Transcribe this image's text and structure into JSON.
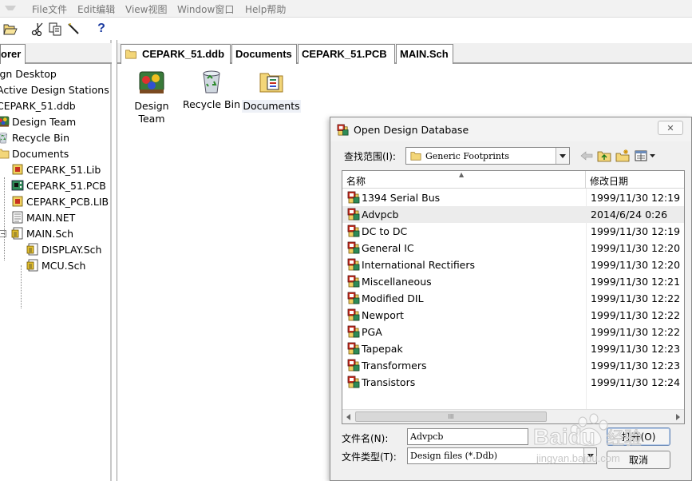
{
  "menubar": {
    "items": [
      "File文件",
      "Edit编辑",
      "View视图",
      "Window窗口",
      "Help帮助"
    ]
  },
  "toolbar": {
    "buttons": [
      "open-folder-icon",
      "cut-icon",
      "copy-icon",
      "paste-icon",
      "help-icon"
    ],
    "help_label": "?"
  },
  "explorer": {
    "tab_label": "orer",
    "tree": [
      {
        "label": "ign Desktop",
        "icon": "desktop-icon"
      },
      {
        "label": "Active Design Stations",
        "icon": "stations-icon"
      },
      {
        "label": "CEPARK_51.ddb",
        "icon": "database-icon"
      },
      {
        "label": "Design Team",
        "icon": "design-team-icon"
      },
      {
        "label": "Recycle Bin",
        "icon": "recycle-bin-icon"
      },
      {
        "label": "Documents",
        "icon": "folder-icon"
      },
      {
        "label": "CEPARK_51.Lib",
        "icon": "schematic-lib-icon"
      },
      {
        "label": "CEPARK_51.PCB",
        "icon": "pcb-icon"
      },
      {
        "label": "CEPARK_PCB.LIB",
        "icon": "pcb-lib-icon"
      },
      {
        "label": "MAIN.NET",
        "icon": "netlist-icon"
      },
      {
        "label": "MAIN.Sch",
        "icon": "schematic-icon"
      },
      {
        "label": "DISPLAY.Sch",
        "icon": "schematic-icon"
      },
      {
        "label": "MCU.Sch",
        "icon": "schematic-icon"
      }
    ],
    "collapse_symbol": "−"
  },
  "main": {
    "tabs": [
      "CEPARK_51.ddb",
      "Documents",
      "CEPARK_51.PCB",
      "MAIN.Sch"
    ],
    "icons": [
      {
        "label_line1": "Design",
        "label_line2": "Team",
        "icon": "design-team-icon"
      },
      {
        "label_line1": "Recycle Bin",
        "label_line2": "",
        "icon": "recycle-bin-icon"
      },
      {
        "label_line1": "Documents",
        "label_line2": "",
        "icon": "documents-icon"
      }
    ]
  },
  "dialog": {
    "title": "Open Design Database",
    "close_symbol": "✕",
    "look_in_label": "查找范围(I):",
    "look_in_value": "Generic Footprints",
    "columns": {
      "name": "名称",
      "modified": "修改日期"
    },
    "files": [
      {
        "name": "1394 Serial Bus",
        "date": "1999/11/30 12:19"
      },
      {
        "name": "Advpcb",
        "date": "2014/6/24 0:26"
      },
      {
        "name": "DC to DC",
        "date": "1999/11/30 12:19"
      },
      {
        "name": "General IC",
        "date": "1999/11/30 12:20"
      },
      {
        "name": "International Rectifiers",
        "date": "1999/11/30 12:20"
      },
      {
        "name": "Miscellaneous",
        "date": "1999/11/30 12:21"
      },
      {
        "name": "Modified DIL",
        "date": "1999/11/30 12:22"
      },
      {
        "name": "Newport",
        "date": "1999/11/30 12:22"
      },
      {
        "name": "PGA",
        "date": "1999/11/30 12:22"
      },
      {
        "name": "Tapepak",
        "date": "1999/11/30 12:23"
      },
      {
        "name": "Transformers",
        "date": "1999/11/30 12:23"
      },
      {
        "name": "Transistors",
        "date": "1999/11/30 12:24"
      }
    ],
    "selected_file": "Advpcb",
    "scroll_grip": "III",
    "file_name_label": "文件名(N):",
    "file_name_value": "Advpcb",
    "file_type_label": "文件类型(T):",
    "file_type_value": "Design files (*.Ddb)",
    "open_button": "打开(O)",
    "cancel_button": "取消"
  },
  "watermark": {
    "text": "Baidu经验",
    "subtext": "jingyan.baidu.com"
  },
  "colors": {
    "accent": "#3a6fb0",
    "selection": "#ececec",
    "pcb_green": "#2e8b57",
    "sch_yellow": "#e8c430"
  }
}
